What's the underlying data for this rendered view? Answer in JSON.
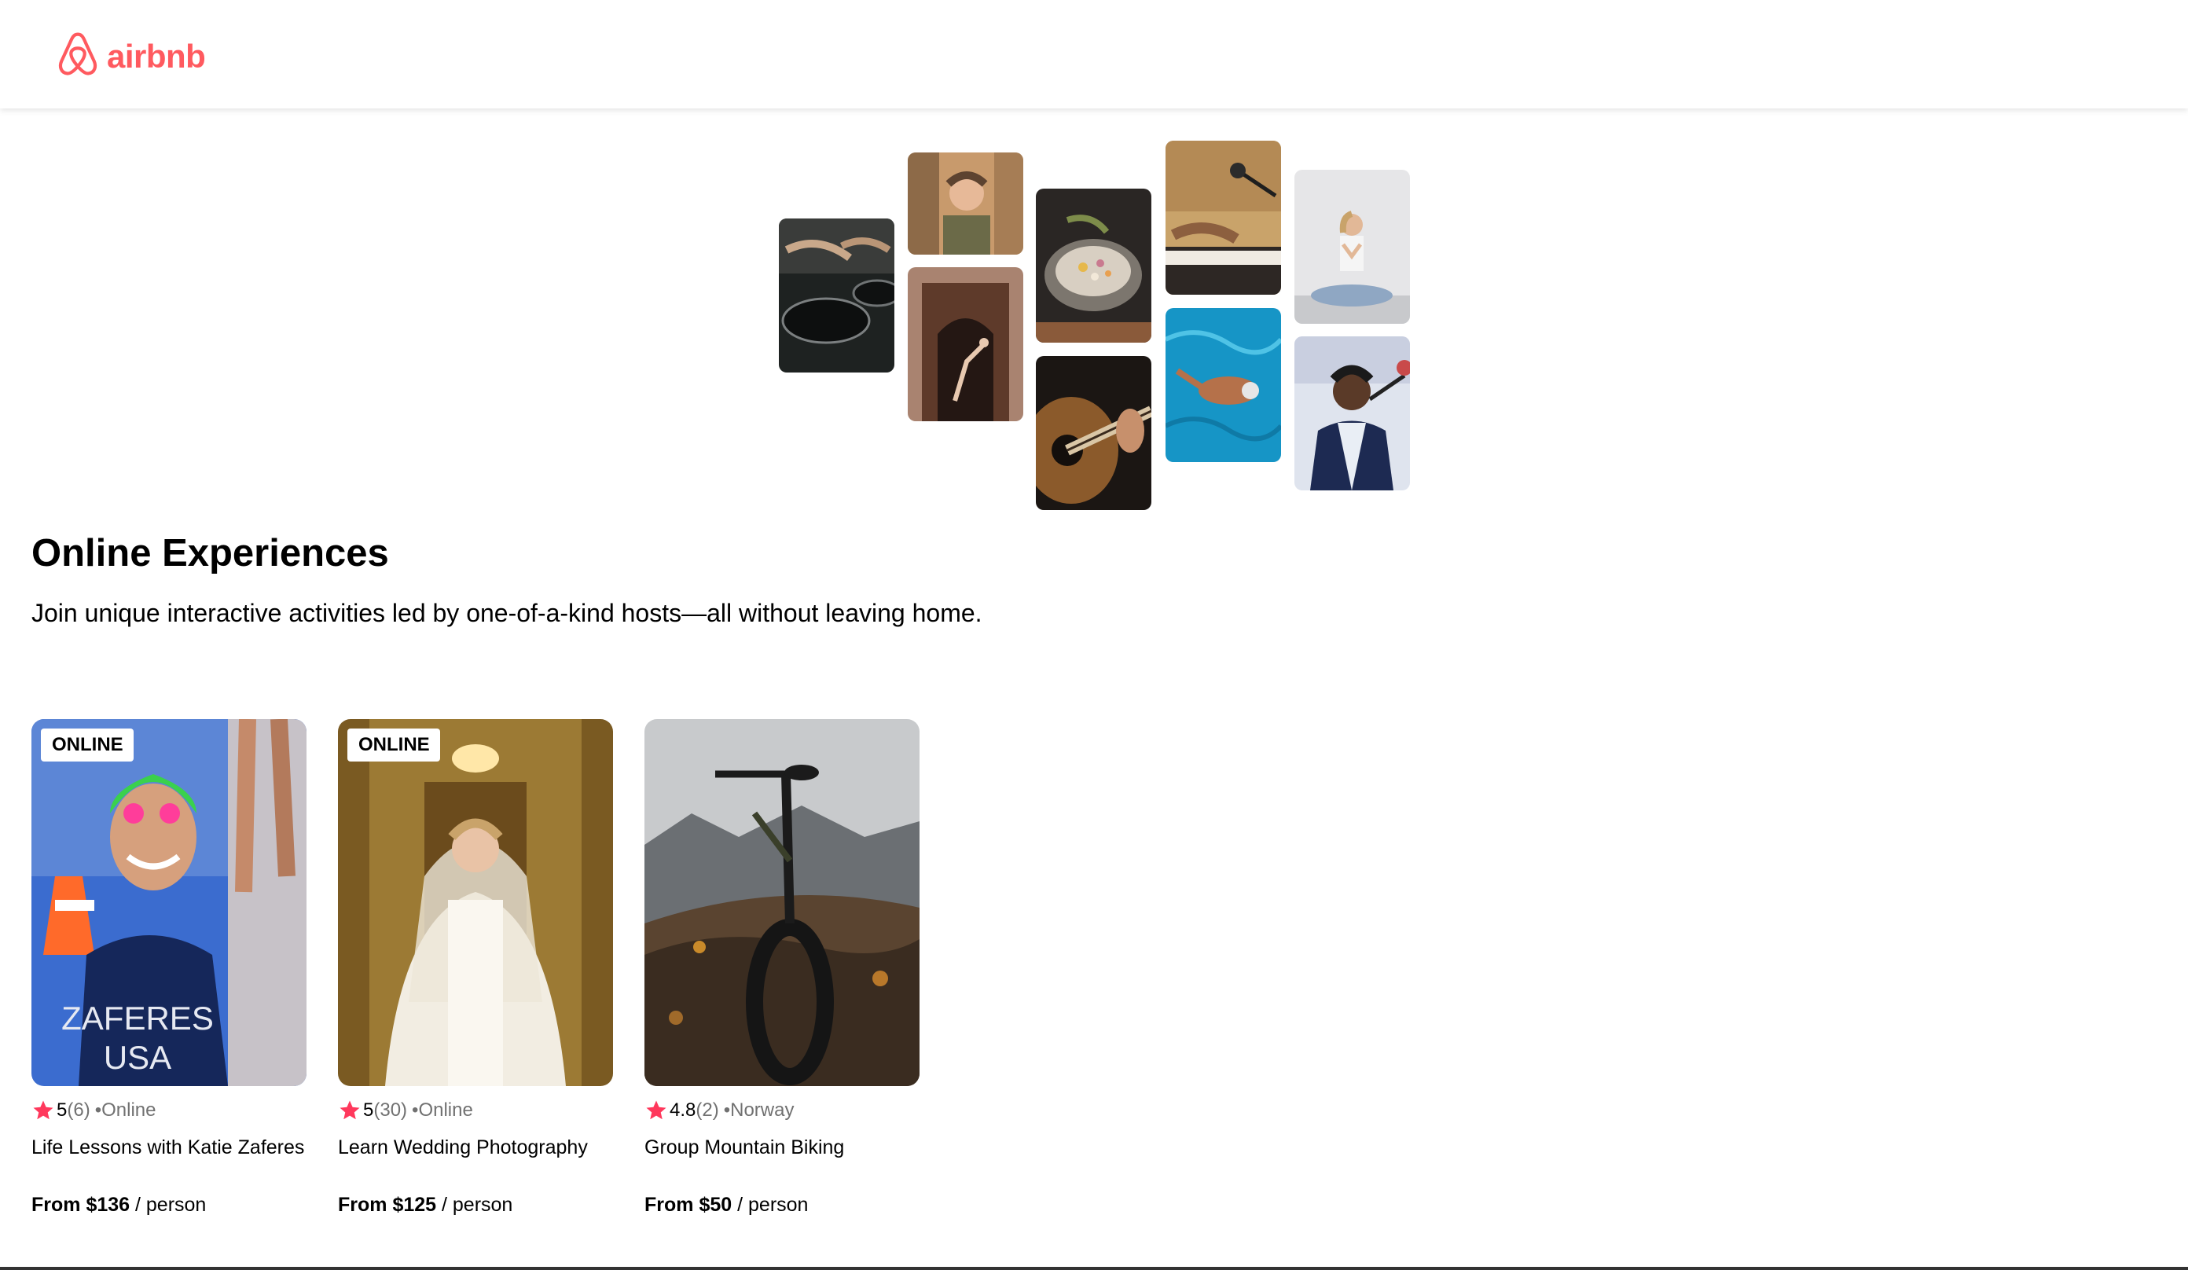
{
  "app": {
    "brand": "airbnb",
    "logo_icon": "airbnb-belo-icon",
    "brand_color": "#ff5a5f"
  },
  "hero": {
    "title": "Online Experiences",
    "subtitle": "Join unique interactive activities led by one-of-a-kind hosts—all without leaving home."
  },
  "mosaic": {
    "photos": [
      {
        "subject": "cooking pans"
      },
      {
        "subject": "smiling host"
      },
      {
        "subject": "dancer in doorway"
      },
      {
        "subject": "food bowl"
      },
      {
        "subject": "acoustic guitar"
      },
      {
        "subject": "piano and microphone"
      },
      {
        "subject": "swimmer in pool"
      },
      {
        "subject": "meditation"
      },
      {
        "subject": "singer with microphone"
      }
    ]
  },
  "star_color": "#ff385c",
  "cards": [
    {
      "badge": "ONLINE",
      "rating": "5",
      "reviews": "(6)",
      "location": "•Online",
      "title": "Life Lessons with Katie Zaferes",
      "price": "From $136",
      "price_unit": " / person",
      "jersey": "ZAFERES",
      "jersey2": "USA"
    },
    {
      "badge": "ONLINE",
      "rating": "5",
      "reviews": "(30)",
      "location": "•Online",
      "title": "Learn Wedding Photography",
      "price": "From $125",
      "price_unit": " / person"
    },
    {
      "rating": "4.8",
      "reviews": "(2)",
      "location": "•Norway",
      "title": "Group Mountain Biking",
      "price": "From $50",
      "price_unit": " / person"
    }
  ]
}
